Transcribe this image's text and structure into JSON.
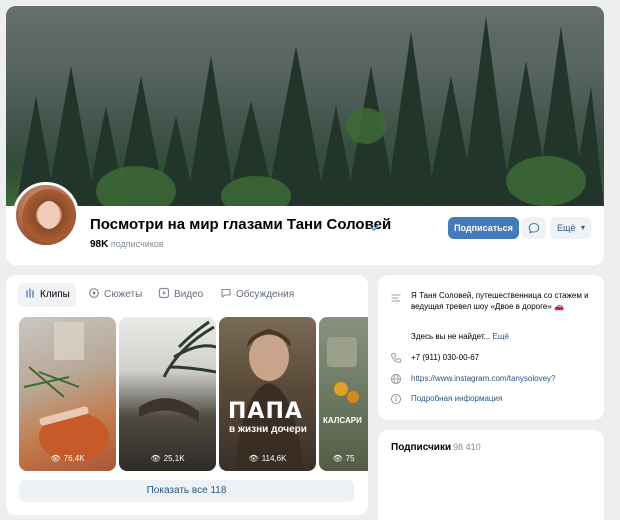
{
  "profile": {
    "name": "Посмотри на мир глазами Тани Соловей",
    "subscribers_count": "98K",
    "subscribers_label": "подписчиков"
  },
  "actions": {
    "subscribe": "Подписаться",
    "more": "Ещё"
  },
  "tabs": [
    {
      "label": "Клипы",
      "icon": "clips-icon",
      "active": true
    },
    {
      "label": "Сюжеты",
      "icon": "stories-icon",
      "active": false
    },
    {
      "label": "Видео",
      "icon": "video-icon",
      "active": false
    },
    {
      "label": "Обсуждения",
      "icon": "discussions-icon",
      "active": false
    }
  ],
  "clips": [
    {
      "views": "76,4K"
    },
    {
      "views": "25,1K",
      "title": ""
    },
    {
      "views": "114,6K",
      "title": "ПАПА",
      "subtitle": "в жизни дочери"
    },
    {
      "views": "75",
      "title": "КАЛСАРИ"
    }
  ],
  "show_all": "Показать все 118",
  "about": {
    "description": "Я Таня Соловей, путешественница со стажем и ведущая тревел шоу «Двое в дороге» 🚗",
    "teaser": "Здесь вы не найдет...",
    "teaser_more": "Ещё",
    "phone": "+7 (911) 030-00-67",
    "website": "https://www.instagram.com/tanysolovey?",
    "details": "Подробная информация"
  },
  "followers": {
    "title": "Подписчики",
    "count": "98 410"
  },
  "colors": {
    "accent": "#447bba",
    "link": "#2a5885",
    "page_bg": "#edeef0"
  }
}
